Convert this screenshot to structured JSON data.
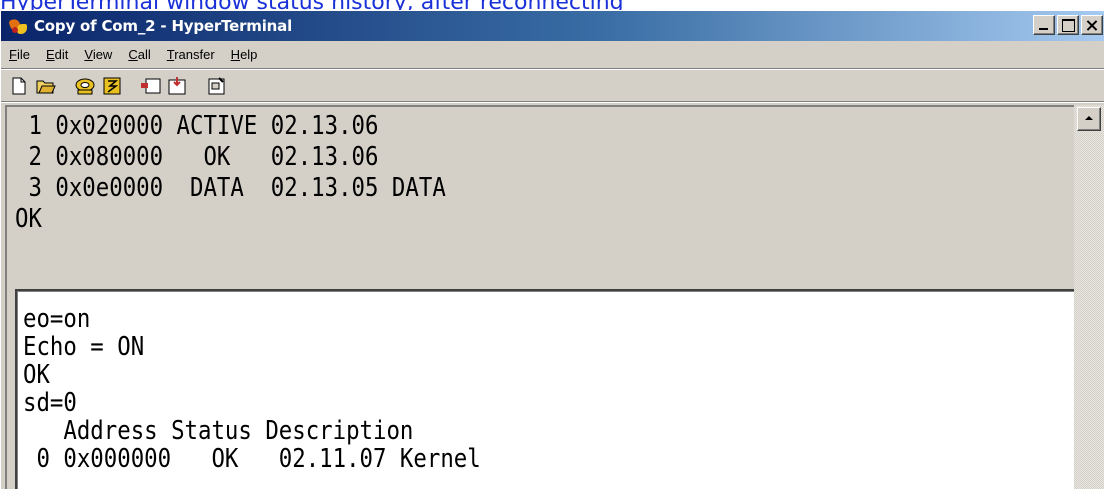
{
  "caption": "HyperTerminal window status history, after reconnecting",
  "window": {
    "title": "Copy of Com_2 - HyperTerminal"
  },
  "menu": [
    {
      "label": "File",
      "accel": "F"
    },
    {
      "label": "Edit",
      "accel": "E"
    },
    {
      "label": "View",
      "accel": "V"
    },
    {
      "label": "Call",
      "accel": "C"
    },
    {
      "label": "Transfer",
      "accel": "T"
    },
    {
      "label": "Help",
      "accel": "H"
    }
  ],
  "toolbar": {
    "icons": [
      "new-icon",
      "open-icon",
      "connect-icon",
      "disconnect-icon",
      "send-icon",
      "receive-icon",
      "properties-icon"
    ]
  },
  "terminal": {
    "history_lines": [
      " 1 0x020000 ACTIVE 02.13.06",
      " 2 0x080000   OK   02.13.06",
      " 3 0x0e0000  DATA  02.13.05 DATA",
      "OK"
    ],
    "current_lines": [
      "eo=on",
      "Echo = ON",
      "OK",
      "sd=0",
      "   Address Status Description",
      " 0 0x000000   OK   02.11.07 Kernel"
    ]
  }
}
